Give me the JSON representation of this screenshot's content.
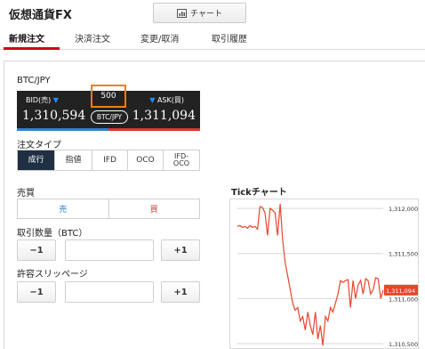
{
  "app": {
    "title": "仮想通貨FX"
  },
  "toolbar": {
    "chart_label": "チャート",
    "chart_icon": "bar-chart-icon"
  },
  "tabs": [
    {
      "label": "新規注文",
      "active": true
    },
    {
      "label": "決済注文",
      "active": false
    },
    {
      "label": "変更/取消",
      "active": false
    },
    {
      "label": "取引履歴",
      "active": false
    }
  ],
  "quote": {
    "pair": "BTC/JPY",
    "bid_label": "BID(売)",
    "ask_label": "ASK(買)",
    "spread": "500",
    "bid_price": "1,310,594",
    "ask_price": "1,311,094",
    "pair_pill": "BTC/JPY",
    "bid_color": "#2f7fd6",
    "ask_color": "#d9372b"
  },
  "order_type": {
    "label": "注文タイプ",
    "options": [
      "成行",
      "指値",
      "IFD",
      "OCO",
      "IFD-\nOCO"
    ],
    "selected": "成行"
  },
  "side": {
    "label": "売買",
    "sell": "売",
    "buy": "買"
  },
  "quantity": {
    "label": "取引数量（BTC）",
    "minus": "−1",
    "plus": "+1",
    "value": ""
  },
  "slippage": {
    "label": "許容スリッページ",
    "minus": "−1",
    "plus": "+1",
    "value": ""
  },
  "chart_data": {
    "type": "line",
    "title": "Tickチャート",
    "xlabel": "",
    "ylabel": "",
    "ylim": [
      1310450,
      1312080
    ],
    "yticks": [
      "1,312,000",
      "1,311,500",
      "1,311,000",
      "1,310,500"
    ],
    "ytick_values": [
      1312000,
      1311500,
      1311000,
      1310500
    ],
    "current_label": "1,311,094",
    "current_value": 1311094,
    "line_color": "#e8452c",
    "grid": true,
    "series": [
      {
        "values": [
          1311800,
          1311810,
          1311790,
          1311800,
          1311780,
          1311810,
          1311790,
          1311800,
          1311770,
          1312020,
          1312010,
          1311950,
          1311700,
          1312000,
          1311980,
          1311950,
          1311700,
          1312050,
          1311650,
          1311400,
          1311250,
          1311100,
          1310950,
          1310870,
          1310900,
          1310750,
          1310800,
          1310650,
          1310850,
          1310700,
          1310600,
          1310850,
          1310550,
          1310700,
          1310480,
          1310800,
          1310750,
          1310900,
          1310850,
          1310950,
          1311050,
          1311200,
          1311180,
          1311200,
          1311210,
          1310900,
          1311200,
          1311000,
          1311150,
          1311200,
          1311050,
          1311220,
          1311200,
          1311050,
          1311100,
          1311230,
          1311220,
          1311000,
          1311094
        ]
      }
    ]
  }
}
